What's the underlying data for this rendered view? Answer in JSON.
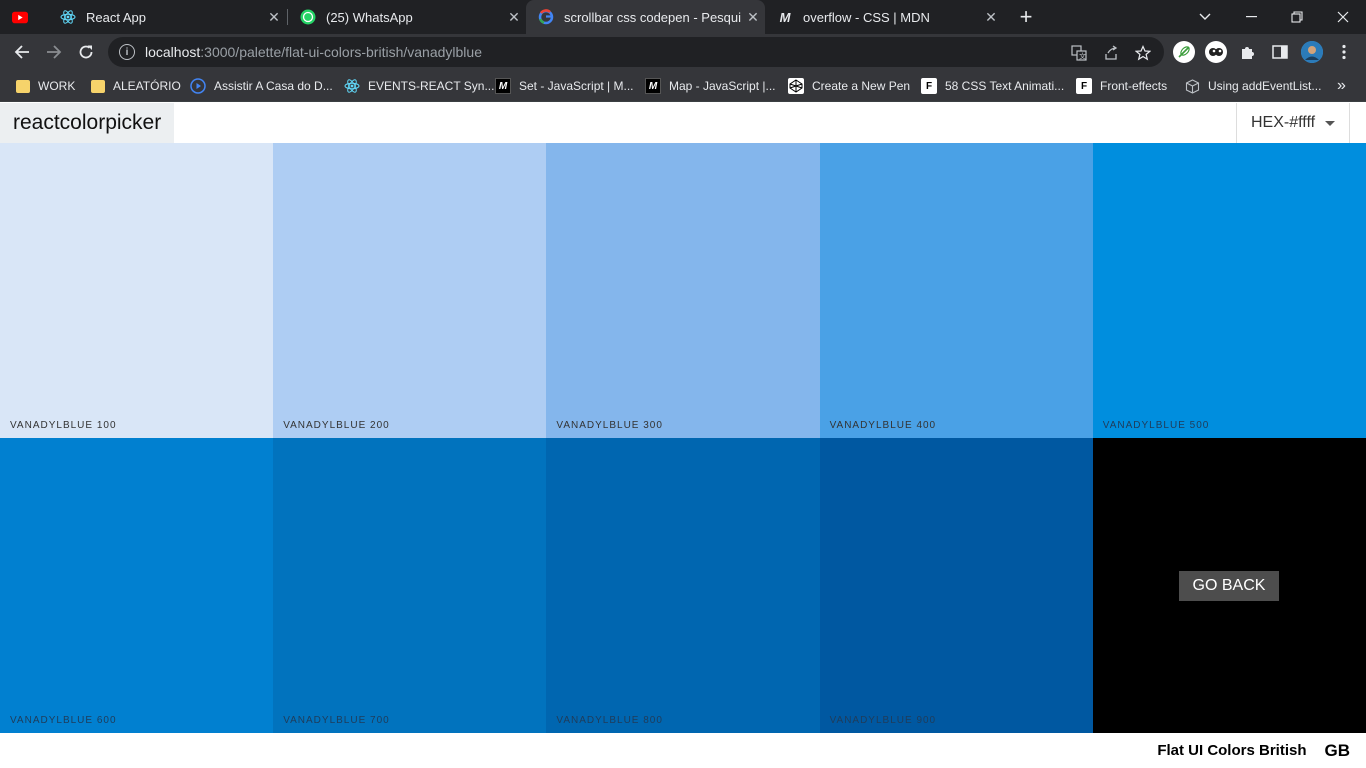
{
  "browser": {
    "tabs": [
      {
        "title": "",
        "favicon": "youtube-icon"
      },
      {
        "title": "React App",
        "favicon": "react-icon"
      },
      {
        "title": "(25) WhatsApp",
        "favicon": "whatsapp-icon"
      },
      {
        "title": "scrollbar css codepen - Pesquisa",
        "favicon": "google-icon"
      },
      {
        "title": "overflow - CSS | MDN",
        "favicon": "mdn-icon"
      }
    ],
    "close_glyph": "✕",
    "new_tab_glyph": "+",
    "url_host": "localhost",
    "url_rest": ":3000/palette/flat-ui-colors-british/vanadylblue",
    "bookmarks": [
      {
        "label": "WORK",
        "icon": "folder-icon"
      },
      {
        "label": "ALEATÓRIO",
        "icon": "folder-icon"
      },
      {
        "label": "Assistir A Casa do D...",
        "icon": "play-icon"
      },
      {
        "label": "EVENTS-REACT Syn...",
        "icon": "react-icon"
      },
      {
        "label": "Set - JavaScript | M...",
        "icon": "mdn-icon"
      },
      {
        "label": "Map - JavaScript |...",
        "icon": "mdn-icon"
      },
      {
        "label": "Create a New Pen",
        "icon": "codepen-icon"
      },
      {
        "label": "58 CSS Text Animati...",
        "icon": "f-icon"
      },
      {
        "label": "Front-effects",
        "icon": "f-icon"
      },
      {
        "label": "Using addEventList...",
        "icon": "cube-icon"
      }
    ],
    "more_bookmarks_glyph": "»"
  },
  "navbar": {
    "logo": "reactcolorpicker",
    "format_select": "HEX-#ffff"
  },
  "palette": {
    "colors": [
      {
        "name": "vanadylblue 100",
        "hex": "#d9e6f7",
        "text": "#333333"
      },
      {
        "name": "vanadylblue 200",
        "hex": "#aecdf3",
        "text": "#333333"
      },
      {
        "name": "vanadylblue 300",
        "hex": "#84b6ec",
        "text": "#333333"
      },
      {
        "name": "vanadylblue 400",
        "hex": "#4aa1e6",
        "text": "#333333"
      },
      {
        "name": "vanadylblue 500",
        "hex": "#008ede",
        "text": "#1f3c5a"
      },
      {
        "name": "vanadylblue 600",
        "hex": "#0180d0",
        "text": "#1f3c5a"
      },
      {
        "name": "vanadylblue 700",
        "hex": "#0173be",
        "text": "#1f3c5a"
      },
      {
        "name": "vanadylblue 800",
        "hex": "#0066b0",
        "text": "#1f3c5a"
      },
      {
        "name": "vanadylblue 900",
        "hex": "#0058a1",
        "text": "#1f3c5a"
      }
    ],
    "go_back": "GO BACK"
  },
  "footer": {
    "palette_name": "Flat UI Colors British",
    "emoji": "GB"
  }
}
